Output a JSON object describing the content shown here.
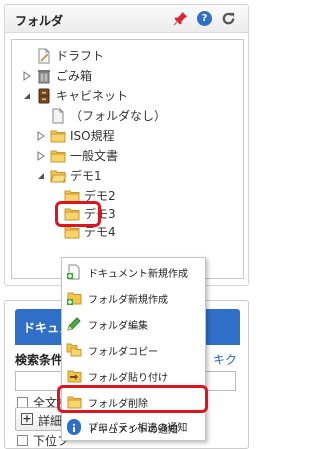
{
  "folder_panel": {
    "title": "フォルダ",
    "icons": [
      "pin-icon",
      "help-icon",
      "refresh-icon"
    ],
    "help_glyph": "?"
  },
  "tree": {
    "draft": "ドラフト",
    "trash": "ごみ箱",
    "cabinet": "キャビネット",
    "no_folder": "（フォルダなし）",
    "iso": "ISO規程",
    "general_docs": "一般文書",
    "demo1": "デモ1",
    "demo2": "デモ2",
    "demo3": "デモ3",
    "demo4": "デモ4"
  },
  "context_menu": {
    "items": [
      {
        "label": "ドキュメント新規作成",
        "icon": "new-document-icon"
      },
      {
        "label": "フォルダ新規作成",
        "icon": "new-folder-icon"
      },
      {
        "label": "フォルダ編集",
        "icon": "edit-pencil-icon"
      },
      {
        "label": "フォルダコピー",
        "icon": "folder-copy-icon"
      },
      {
        "label": "フォルダ貼り付け",
        "icon": "folder-paste-icon"
      },
      {
        "label": "フォルダ削除",
        "icon": "folder-delete-icon"
      },
      {
        "label": "プロパティ相違の通知",
        "icon": "info-icon"
      },
      {
        "label": "ドキュメントの通知",
        "icon": "info-icon"
      }
    ]
  },
  "doc_panel": {
    "tab_label": "ドキュメ",
    "search_conditions": "検索条件",
    "clear_link": "キクリア",
    "fulltext_label": "全文検",
    "detail_label": "詳細",
    "subfolder_label": "下位フ"
  },
  "colors": {
    "accent": "#2f6fc7",
    "highlight": "#e0141e"
  }
}
